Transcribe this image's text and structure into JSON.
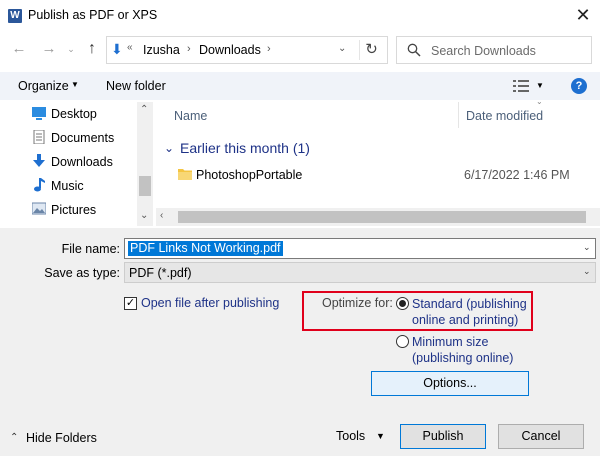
{
  "window": {
    "title": "Publish as PDF or XPS",
    "app_icon_letter": "W"
  },
  "nav": {
    "breadcrumb": [
      "Izusha",
      "Downloads"
    ],
    "search_placeholder": "Search Downloads"
  },
  "toolbar": {
    "organize": "Organize",
    "new_folder": "New folder"
  },
  "sidebar": {
    "items": [
      {
        "label": "Desktop",
        "icon": "desktop-icon"
      },
      {
        "label": "Documents",
        "icon": "documents-icon"
      },
      {
        "label": "Downloads",
        "icon": "downloads-icon"
      },
      {
        "label": "Music",
        "icon": "music-icon"
      },
      {
        "label": "Pictures",
        "icon": "pictures-icon"
      }
    ]
  },
  "filelist": {
    "columns": {
      "name": "Name",
      "date": "Date modified"
    },
    "group": "Earlier this month (1)",
    "files": [
      {
        "name": "PhotoshopPortable",
        "date": "6/17/2022 1:46 PM"
      }
    ]
  },
  "form": {
    "filename_label": "File name:",
    "filename_value": "PDF Links Not Working.pdf",
    "savetype_label": "Save as type:",
    "savetype_value": "PDF (*.pdf)",
    "open_after": "Open file after publishing",
    "optimize_label": "Optimize for:",
    "standard_line1": "Standard (publishing",
    "standard_line2": "online and printing)",
    "minimum_line1": "Minimum size",
    "minimum_line2": "(publishing online)",
    "options": "Options..."
  },
  "footer": {
    "hide_folders": "Hide Folders",
    "tools": "Tools",
    "publish": "Publish",
    "cancel": "Cancel"
  },
  "colors": {
    "accent": "#0078d7",
    "highlight": "#e0001b",
    "link": "#1e3287"
  }
}
